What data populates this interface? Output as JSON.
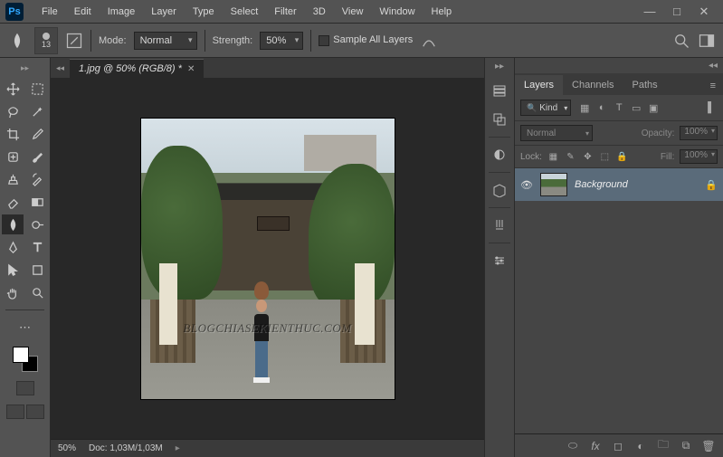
{
  "app": {
    "logo": "Ps"
  },
  "menu": [
    "File",
    "Edit",
    "Image",
    "Layer",
    "Type",
    "Select",
    "Filter",
    "3D",
    "View",
    "Window",
    "Help"
  ],
  "optbar": {
    "brush_size": "13",
    "mode_label": "Mode:",
    "mode_value": "Normal",
    "strength_label": "Strength:",
    "strength_value": "50%",
    "sample_all": "Sample All Layers"
  },
  "document": {
    "tab": "1.jpg @ 50% (RGB/8) *",
    "zoom": "50%",
    "doc_info": "Doc: 1,03M/1,03M",
    "watermark": "BLOGCHIASEKIENTHUC.COM"
  },
  "panels": {
    "tabs": {
      "layers": "Layers",
      "channels": "Channels",
      "paths": "Paths"
    },
    "filter_kind": "Kind",
    "blend_mode": "Normal",
    "opacity_label": "Opacity:",
    "opacity_value": "100%",
    "lock_label": "Lock:",
    "fill_label": "Fill:",
    "fill_value": "100%",
    "layer": {
      "name": "Background"
    }
  }
}
